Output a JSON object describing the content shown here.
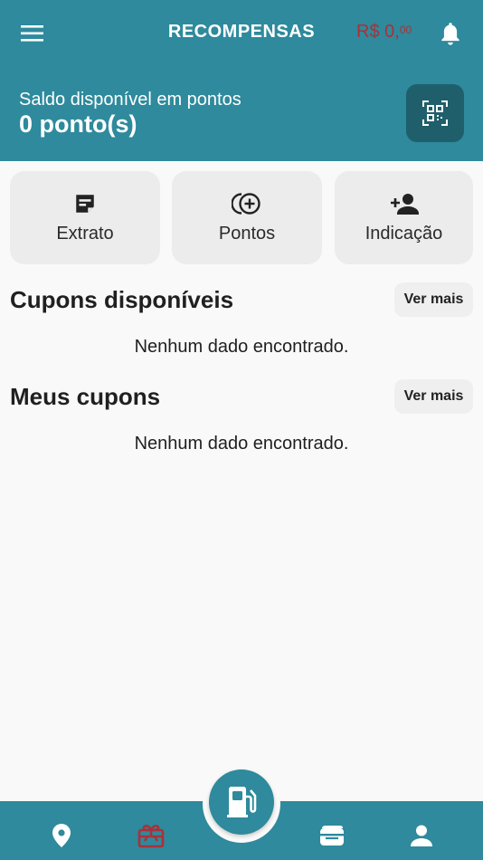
{
  "header": {
    "title": "RECOMPENSAS",
    "wallet_currency_int": "R$ 0,",
    "wallet_cents": "00",
    "menu_icon": "hamburger-menu-icon",
    "bell_icon": "bell-icon"
  },
  "balance": {
    "label": "Saldo disponível em pontos",
    "value": "0 ponto(s)",
    "qr_icon": "qr-code-scan-icon"
  },
  "actions": [
    {
      "label": "Extrato",
      "icon": "note-icon"
    },
    {
      "label": "Pontos",
      "icon": "coin-add-icon"
    },
    {
      "label": "Indicação",
      "icon": "person-add-icon"
    }
  ],
  "sections": {
    "available": {
      "title": "Cupons disponíveis",
      "see_more": "Ver mais",
      "empty": "Nenhum dado encontrado."
    },
    "mine": {
      "title": "Meus cupons",
      "see_more": "Ver mais",
      "empty": "Nenhum dado encontrado."
    }
  },
  "bottom_nav": {
    "items": [
      "location-pin-icon",
      "gift-card-icon",
      "wallet-icon",
      "profile-icon"
    ],
    "fab_icon": "fuel-pump-icon",
    "active_item": "gift-card-icon"
  },
  "colors": {
    "primary": "#2e8a9c",
    "primary_dark": "#1f5f6b",
    "accent": "#a8323a",
    "background": "#f9f9f9",
    "card": "#ececec"
  }
}
